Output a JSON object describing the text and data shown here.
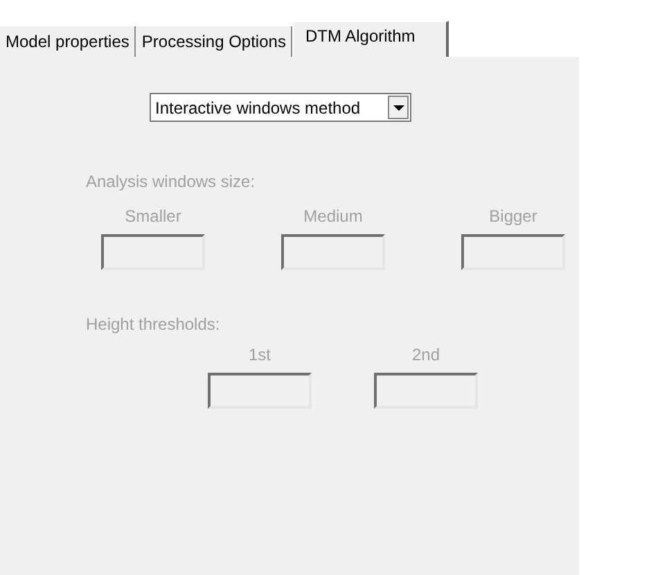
{
  "tabs": [
    {
      "label": "Model properties",
      "selected": false
    },
    {
      "label": "Processing Options",
      "selected": false
    },
    {
      "label": "DTM Algorithm",
      "selected": true
    }
  ],
  "method_dropdown": {
    "value": "Interactive windows method"
  },
  "groups": [
    {
      "label": "Analysis windows size:",
      "disabled": true,
      "fields": [
        {
          "label": "Smaller"
        },
        {
          "label": "Medium"
        },
        {
          "label": "Bigger"
        }
      ]
    },
    {
      "label": "Height thresholds:",
      "disabled": true,
      "fields": [
        {
          "label": "1st"
        },
        {
          "label": "2nd"
        }
      ]
    }
  ]
}
